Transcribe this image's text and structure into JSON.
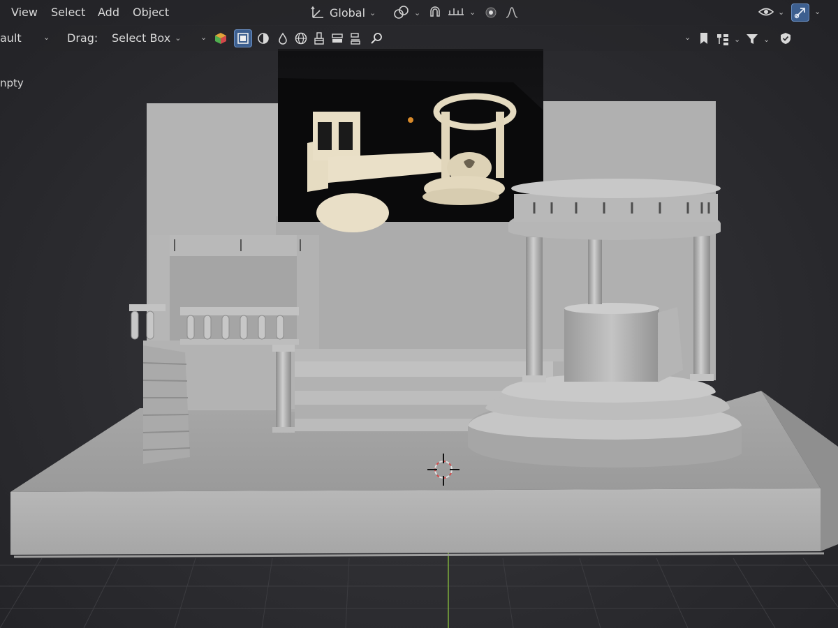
{
  "menu": {
    "view": "View",
    "select": "Select",
    "add": "Add",
    "object": "Object"
  },
  "transform": {
    "orientation": "Global"
  },
  "toolbar": {
    "mode_label": "ault",
    "drag_label": "Drag:",
    "drag_value": "Select Box"
  },
  "scene": {
    "empty_label": "npty"
  },
  "icons": {
    "orientation": "transform-orientation-icon",
    "pivot": "link-pivot-icon",
    "snap": "snap-magnet-icon",
    "snap_increment": "snap-increment-icon",
    "proportional": "proportional-editing-icon",
    "falloff": "falloff-curve-icon",
    "visibility": "eye-icon",
    "gizmo": "gizmo-icon",
    "object_color": "color-cube-icon",
    "select_box": "select-box-icon",
    "xray": "xray-icon",
    "shading": "shading-icon",
    "globe": "globe-icon",
    "brush": "brush-icon",
    "layers": "layers-icon",
    "transfer": "transfer-icon",
    "search": "search-icon",
    "bookmark": "bookmark-icon",
    "hierarchy": "hierarchy-icon",
    "filter": "filter-icon",
    "shield": "shield-icon"
  },
  "colors": {
    "accent_active": "#3d5f8f",
    "header_bg": "#242428",
    "model_light": "#bdbdbd",
    "model_shadow": "#8e8e8e"
  }
}
